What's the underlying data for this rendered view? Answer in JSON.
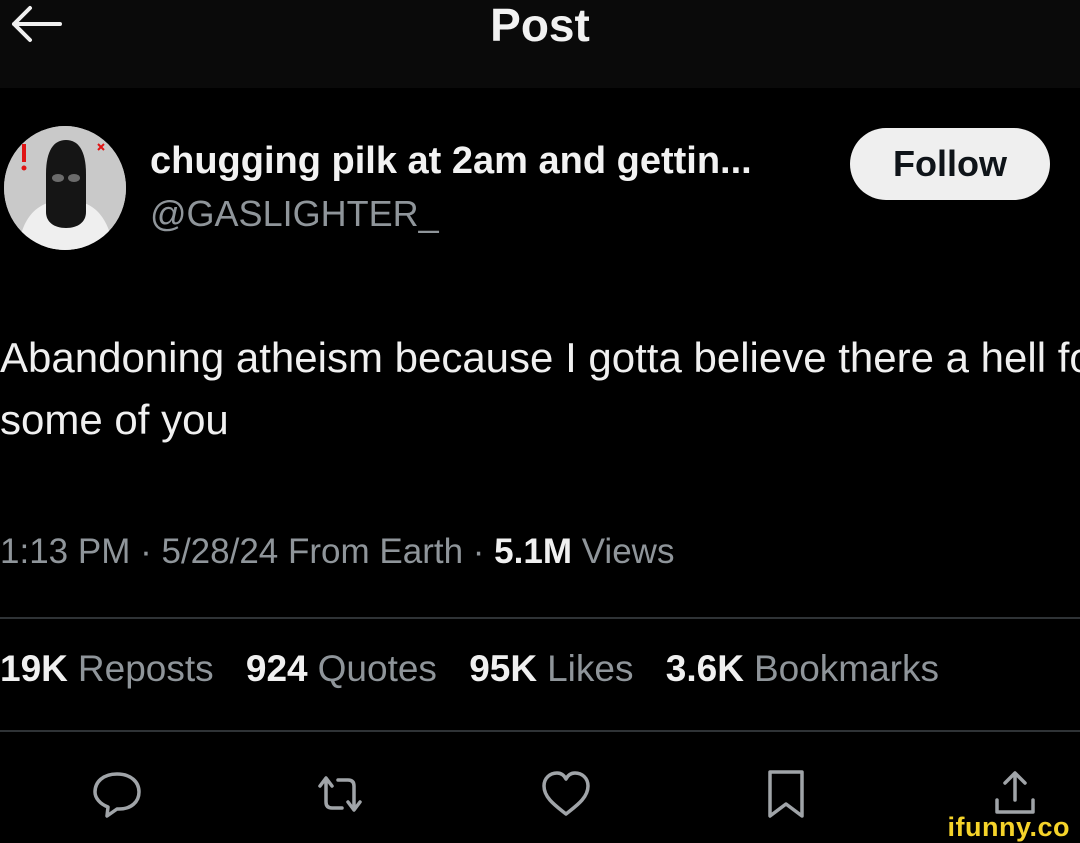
{
  "header": {
    "title": "Post",
    "back_icon": "arrow-left-icon"
  },
  "author": {
    "display_name": "chugging pilk at 2am and gettin...",
    "handle": "@GASLIGHTER_",
    "follow_label": "Follow",
    "avatar": "avatar-image"
  },
  "post": {
    "text": "Abandoning atheism because I gotta believe there a hell for some of you",
    "time": "1:13 PM",
    "date": "5/28/24",
    "location": "From Earth",
    "views_count": "5.1M",
    "views_label": "Views",
    "separator": "·"
  },
  "stats": [
    {
      "count": "19K",
      "label": "Reposts"
    },
    {
      "count": "924",
      "label": "Quotes"
    },
    {
      "count": "95K",
      "label": "Likes"
    },
    {
      "count": "3.6K",
      "label": "Bookmarks"
    }
  ],
  "actions": [
    {
      "name": "reply",
      "icon": "comment-icon"
    },
    {
      "name": "repost",
      "icon": "repost-icon"
    },
    {
      "name": "like",
      "icon": "heart-icon"
    },
    {
      "name": "bookmark",
      "icon": "bookmark-icon"
    },
    {
      "name": "share",
      "icon": "share-icon"
    }
  ],
  "watermark": "ifunny.co",
  "colors": {
    "background": "#000000",
    "text": "#e7e9ea",
    "secondary": "#8f959a",
    "divider": "#2f3336",
    "follow_bg": "#efefef",
    "watermark": "#f5d32a"
  }
}
